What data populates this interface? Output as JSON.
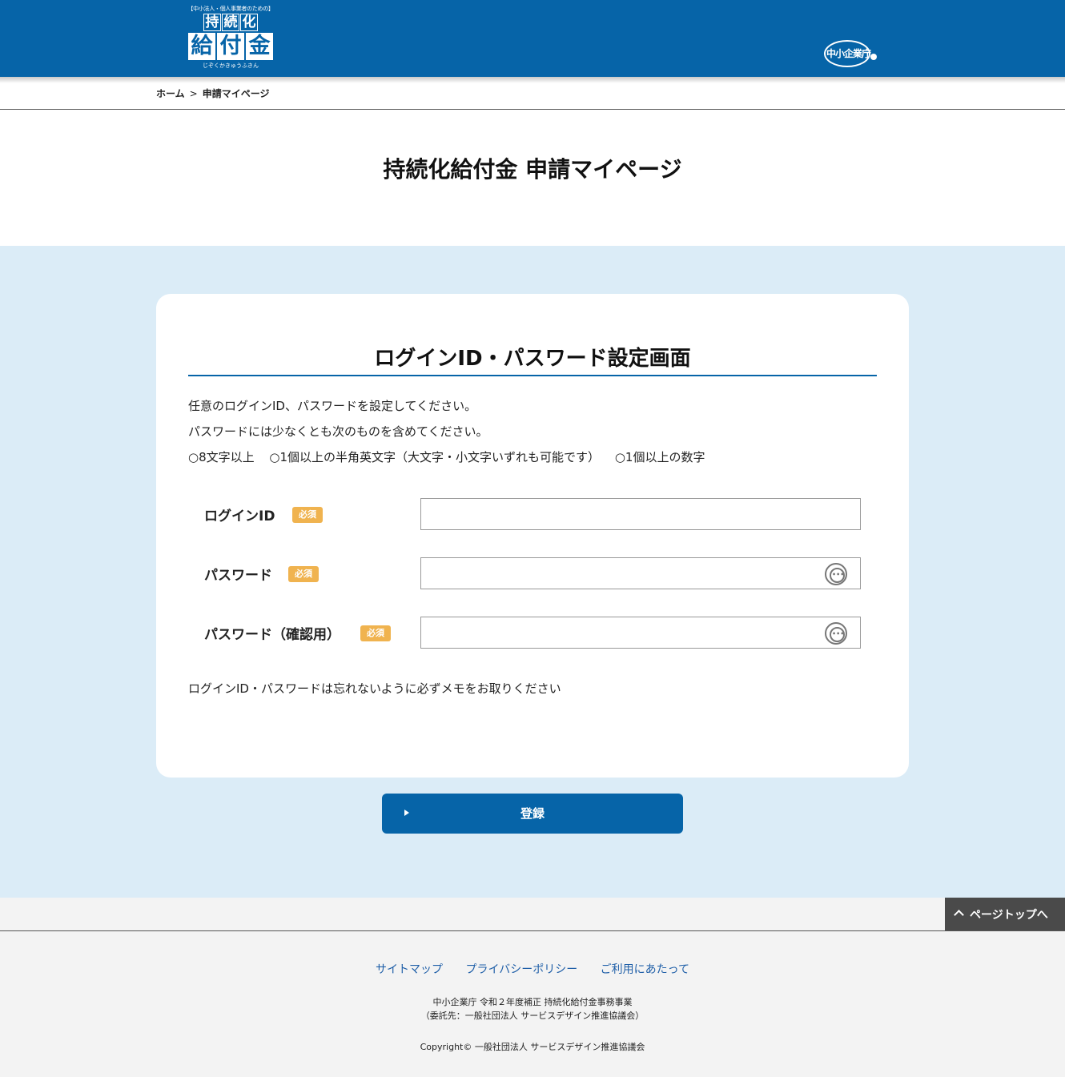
{
  "header": {
    "logo": {
      "tagline": "【中小法人・個人事業者のための】",
      "row1": [
        "持",
        "続",
        "化"
      ],
      "row2": [
        "給",
        "付",
        "金"
      ],
      "reading": "じぞくかきゅうふきん"
    },
    "agency_logo_text": "中小企業庁"
  },
  "breadcrumb": {
    "home": "ホーム",
    "separator": ">",
    "current": "申請マイページ"
  },
  "page_title": "持続化給付金 申請マイページ",
  "card": {
    "title": "ログインID・パスワード設定画面",
    "intro_line1": "任意のログインID、パスワードを設定してください。",
    "intro_line2": "パスワードには少なくとも次のものを含めてください。",
    "requirements": [
      "○8文字以上",
      "○1個以上の半角英文字（大文字・小文字いずれも可能です）",
      "○1個以上の数字"
    ],
    "fields": {
      "login_id": {
        "label": "ログインID",
        "badge": "必須",
        "value": ""
      },
      "password": {
        "label": "パスワード",
        "badge": "必須",
        "value": ""
      },
      "password_confirm": {
        "label": "パスワード（確認用）",
        "badge": "必須",
        "value": ""
      }
    },
    "note": "ログインID・パスワードは忘れないように必ずメモをお取りください"
  },
  "submit_label": "登録",
  "page_top_label": "ページトップへ",
  "footer": {
    "links": [
      "サイトマップ",
      "プライバシーポリシー",
      "ご利用にあたって"
    ],
    "line1": "中小企業庁 令和２年度補正 持続化給付金事務事業",
    "line2": "（委託先：一般社団法人 サービスデザイン推進協議会）",
    "copyright": "Copyright© 一般社団法人 サービスデザイン推進協議会"
  },
  "colors": {
    "brand_blue": "#0664a8",
    "section_bg": "#dbecf7",
    "badge": "#f0b34f",
    "link": "#1f5fa8"
  },
  "icons": [
    "password-visibility-icon",
    "triangle-right-icon",
    "chevron-up-icon"
  ]
}
